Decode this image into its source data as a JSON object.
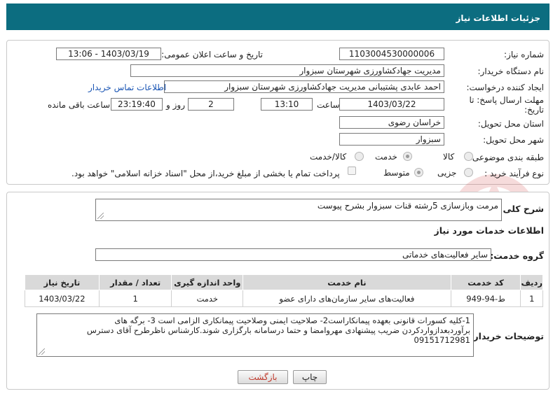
{
  "header": {
    "title": "جزئیات اطلاعات نیاز"
  },
  "fields": {
    "need_number": {
      "label": "شماره نیاز:",
      "value": "1103004530000006"
    },
    "announce_datetime": {
      "label": "تاریخ و ساعت اعلان عمومی:",
      "value": "1403/03/19 - 13:06"
    },
    "buyer_org": {
      "label": "نام دستگاه خریدار:",
      "value": "مدیریت جهادکشاورزی شهرستان سبزوار"
    },
    "requester": {
      "label": "ایجاد کننده درخواست:",
      "value": "احمد عابدی پشتیبانی مدیریت جهادکشاورزی شهرستان سبزوار"
    },
    "buyer_contact_link": "اطلاعات تماس خریدار",
    "deadline": {
      "label": "مهلت ارسال پاسخ: تا تاریخ:",
      "date": "1403/03/22",
      "time_label": "ساعت",
      "time": "13:10",
      "days": "2",
      "days_label": "روز و",
      "remaining": "23:19:40",
      "remaining_label": "ساعت باقی مانده"
    },
    "province": {
      "label": "استان محل تحویل:",
      "value": "خراسان رضوی"
    },
    "city": {
      "label": "شهر محل تحویل:",
      "value": "سبزوار"
    },
    "category": {
      "label": "طبقه بندی موضوعی:",
      "options": [
        "کالا",
        "خدمت",
        "کالا/خدمت"
      ],
      "selected": "خدمت"
    },
    "purchase_type": {
      "label": "نوع فرآیند خرید :",
      "options": [
        "جزیی",
        "متوسط"
      ],
      "selected": "متوسط",
      "payment_note": "پرداخت تمام یا بخشی از مبلغ خرید،از محل \"اسناد خزانه اسلامی\" خواهد بود."
    }
  },
  "summary": {
    "label": "شرح کلی نیاز:",
    "value": "مرمت وبازسازی 5رشته قنات سبزوار بشرح پیوست"
  },
  "services_heading": "اطلاعات خدمات مورد نیاز",
  "service_group": {
    "label": "گروه خدمت:",
    "value": "سایر فعالیت‌های خدماتی"
  },
  "table": {
    "headers": [
      "ردیف",
      "کد خدمت",
      "نام خدمت",
      "واحد اندازه گیری",
      "تعداد / مقدار",
      "تاریخ نیاز"
    ],
    "rows": [
      [
        "1",
        "ط-94-949",
        "فعالیت‌های سایر سازمان‌های دارای عضو",
        "خدمت",
        "1",
        "1403/03/22"
      ]
    ]
  },
  "buyer_notes": {
    "label": "توضیحات خریدار:",
    "lines": [
      "1-کلیه کسورات قانونی بعهده پیمانکاراست2- صلاحیت ایمنی وصلاحیت پیمانکاری الزامی است 3- برگه های",
      "برآوردبعدازواردکردن ضریب پیشنهادی مهروامضا و حتما درسامانه بارگزاری شوند.کارشناس ناظرطرح آقای دسترس",
      "09151712981"
    ]
  },
  "buttons": {
    "print": "چاپ",
    "back": "بازگشت"
  },
  "colors": {
    "header_bg": "#0c6d80",
    "link": "#1a55b4",
    "back_text": "#c0392b"
  }
}
